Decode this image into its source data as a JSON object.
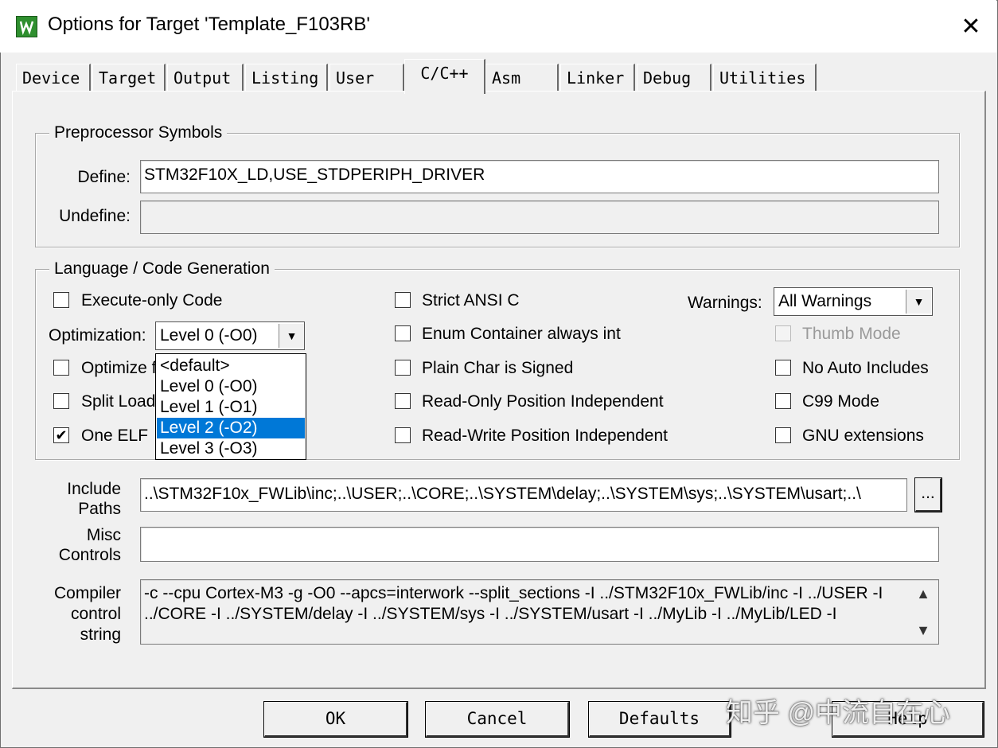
{
  "window": {
    "title": "Options for Target 'Template_F103RB'",
    "close_glyph": "✕"
  },
  "tabs": [
    {
      "label": "Device"
    },
    {
      "label": "Target"
    },
    {
      "label": "Output"
    },
    {
      "label": "Listing"
    },
    {
      "label": "User"
    },
    {
      "label": "C/C++",
      "active": true
    },
    {
      "label": "Asm"
    },
    {
      "label": "Linker"
    },
    {
      "label": "Debug"
    },
    {
      "label": "Utilities"
    }
  ],
  "preprocessor": {
    "legend": "Preprocessor Symbols",
    "define_label": "Define:",
    "define_value": "STM32F10X_LD,USE_STDPERIPH_DRIVER",
    "undefine_label": "Undefine:",
    "undefine_value": ""
  },
  "language": {
    "legend": "Language / Code Generation",
    "execute_only": {
      "label": "Execute-only Code",
      "checked": false
    },
    "optimization_label": "Optimization:",
    "optimization_value": "Level 0 (-O0)",
    "optimize_time": {
      "label": "Optimize f",
      "checked": false
    },
    "split_load": {
      "label": "Split Load",
      "checked": false
    },
    "one_elf": {
      "label": "One ELF",
      "checked": true,
      "check_glyph": "✔"
    },
    "strict_ansi": {
      "label": "Strict ANSI C",
      "checked": false
    },
    "enum_container": {
      "label": "Enum Container always int",
      "checked": false
    },
    "plain_char": {
      "label": "Plain Char is Signed",
      "checked": false
    },
    "ro_pi": {
      "label": "Read-Only Position Independent",
      "checked": false
    },
    "rw_pi": {
      "label": "Read-Write Position Independent",
      "checked": false
    },
    "warnings_label": "Warnings:",
    "warnings_value": "All Warnings",
    "thumb_mode": {
      "label": "Thumb Mode",
      "checked": false,
      "disabled": true
    },
    "no_auto_includes": {
      "label": "No Auto Includes",
      "checked": false
    },
    "c99_mode": {
      "label": "C99 Mode",
      "checked": false
    },
    "gnu_extensions": {
      "label": "GNU extensions",
      "checked": false
    }
  },
  "optimization_dropdown": {
    "options": [
      "<default>",
      "Level 0 (-O0)",
      "Level 1 (-O1)",
      "Level 2 (-O2)",
      "Level 3 (-O3)"
    ],
    "highlighted": "Level 2 (-O2)"
  },
  "include_paths": {
    "label_line1": "Include",
    "label_line2": "Paths",
    "value": "..\\STM32F10x_FWLib\\inc;..\\USER;..\\CORE;..\\SYSTEM\\delay;..\\SYSTEM\\sys;..\\SYSTEM\\usart;..\\",
    "browse_label": "..."
  },
  "misc_controls": {
    "label_line1": "Misc",
    "label_line2": "Controls",
    "value": ""
  },
  "compiler_control": {
    "label_line1": "Compiler",
    "label_line2": "control",
    "label_line3": "string",
    "line1": "-c --cpu Cortex-M3 -g -O0 --apcs=interwork --split_sections -I ../STM32F10x_FWLib/inc -I ../USER -I",
    "line2": "../CORE -I ../SYSTEM/delay -I ../SYSTEM/sys -I ../SYSTEM/usart -I ../MyLib -I ../MyLib/LED -I"
  },
  "buttons": {
    "ok": "OK",
    "cancel": "Cancel",
    "defaults": "Defaults",
    "help": "Help"
  },
  "watermark": "知乎 @中流自在心",
  "icons": {
    "up": "▲",
    "down": "▼",
    "combo_arrow": "▼"
  }
}
